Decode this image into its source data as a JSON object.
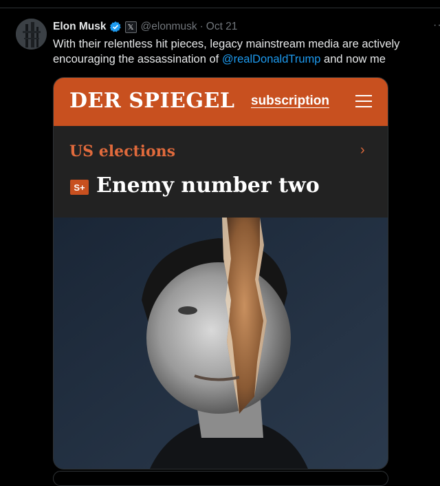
{
  "tweet": {
    "author_name": "Elon Musk",
    "handle": "@elonmusk",
    "separator": "·",
    "date": "Oct 21",
    "more_label": "···",
    "text_before": "With their relentless hit pieces, legacy mainstream media are actively encouraging the assassination of ",
    "mention": "@realDonaldTrump",
    "text_after": " and now me",
    "verified_color": "#1d9bf0",
    "affiliate_badge": "𝕏"
  },
  "media": {
    "logo": "DER SPIEGEL",
    "subscription_label": "subscription",
    "menu_icon": "hamburger-menu-icon",
    "category": "US elections",
    "chevron": "›",
    "badge": "S+",
    "headline": "Enemy number two",
    "brand_color": "#c8501f",
    "accent_color": "#e06a3c"
  }
}
